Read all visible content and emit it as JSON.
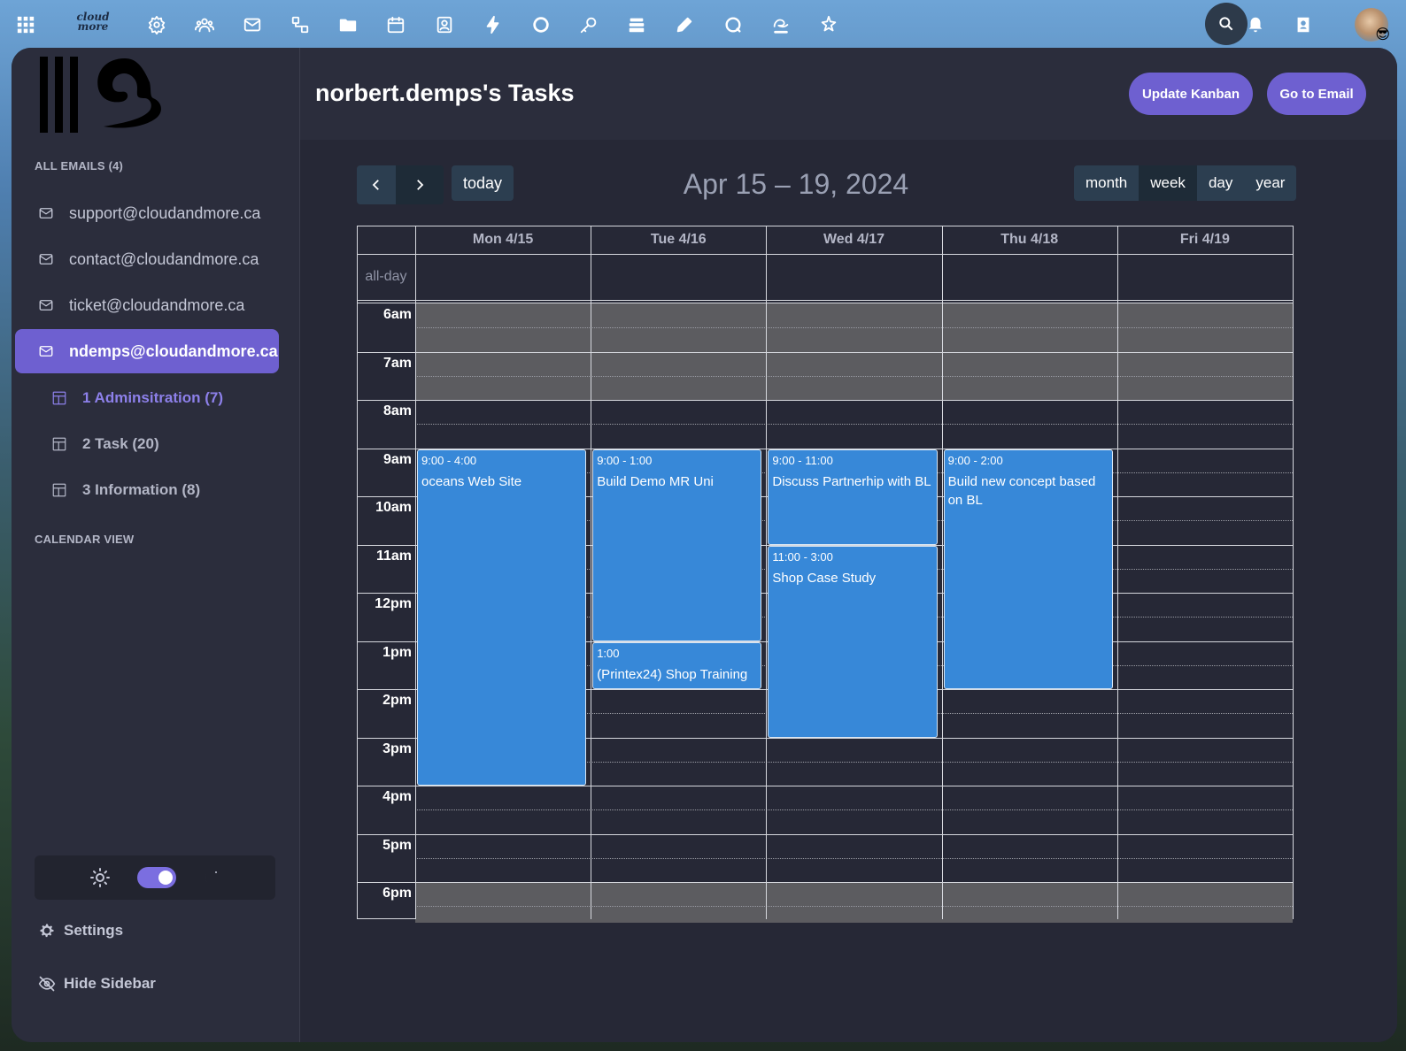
{
  "topbar": {
    "logo": {
      "line1": "cloud",
      "line2": "more"
    },
    "icons": [
      "apps-grid-icon",
      "logo",
      "gear-icon",
      "people-icon",
      "mail-icon",
      "flow-icon",
      "folder-icon",
      "calendar-icon",
      "contact-card-icon",
      "lightning-icon",
      "circle-icon",
      "key-icon",
      "stack-icon",
      "pencil-icon",
      "chat-icon",
      "kanban-icon",
      "sparkle-icon"
    ],
    "right_icons": [
      "search-icon",
      "bell-icon",
      "address-book-icon",
      "avatar"
    ]
  },
  "sidebar": {
    "all_emails_label": "ALL EMAILS (4)",
    "emails": [
      {
        "label": "support@cloudandmore.ca",
        "active": false
      },
      {
        "label": "contact@cloudandmore.ca",
        "active": false
      },
      {
        "label": "ticket@cloudandmore.ca",
        "active": false
      },
      {
        "label": "ndemps@cloudandmore.ca",
        "active": true
      }
    ],
    "boards": [
      {
        "label": "1 Adminsitration (7)",
        "active": true
      },
      {
        "label": "2 Task (20)",
        "active": false
      },
      {
        "label": "3 Information (8)",
        "active": false
      }
    ],
    "calendar_view_label": "CALENDAR VIEW",
    "theme": {
      "mode": "dark"
    },
    "settings_label": "Settings",
    "hide_sidebar_label": "Hide Sidebar"
  },
  "header": {
    "title": "norbert.demps's Tasks",
    "update_kanban_label": "Update Kanban",
    "go_to_email_label": "Go to Email"
  },
  "calendar": {
    "today_label": "today",
    "range_title": "Apr 15 – 19, 2024",
    "views": [
      {
        "label": "month",
        "active": false
      },
      {
        "label": "week",
        "active": true
      },
      {
        "label": "day",
        "active": false
      },
      {
        "label": "year",
        "active": false
      }
    ],
    "days": [
      "Mon 4/15",
      "Tue 4/16",
      "Wed 4/17",
      "Thu 4/18",
      "Fri 4/19"
    ],
    "all_day_label": "all-day",
    "time_labels": [
      "6am",
      "7am",
      "8am",
      "9am",
      "10am",
      "11am",
      "12pm",
      "1pm",
      "2pm",
      "3pm",
      "4pm",
      "5pm",
      "6pm"
    ],
    "events": [
      {
        "day": 0,
        "start": 9,
        "end": 16,
        "time": "9:00 - 4:00",
        "title": "oceans Web Site"
      },
      {
        "day": 1,
        "start": 9,
        "end": 13,
        "time": "9:00 - 1:00",
        "title": "Build Demo MR Uni"
      },
      {
        "day": 1,
        "start": 13,
        "end": 14,
        "time": "1:00",
        "title": "(Printex24) Shop Training"
      },
      {
        "day": 2,
        "start": 9,
        "end": 11,
        "time": "9:00 - 11:00",
        "title": "Discuss Partnerhip with BL"
      },
      {
        "day": 2,
        "start": 11,
        "end": 15,
        "time": "11:00 - 3:00",
        "title": "Shop Case Study"
      },
      {
        "day": 3,
        "start": 9,
        "end": 14,
        "time": "9:00 - 2:00",
        "title": "Build new concept based on BL"
      }
    ]
  }
}
